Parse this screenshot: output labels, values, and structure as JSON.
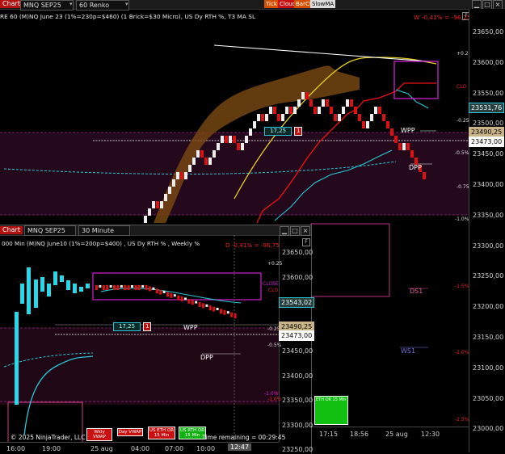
{
  "top": {
    "title_tab": "Chart",
    "instrument": "MNQ SEP25",
    "bar_type": "60 Renko",
    "header_text": "RE 60 (M)NQ June 23 (1%=230p=$460) (1 Brick=$30 Micro), US Dy RTH %, T3 MA SL",
    "pct_readout": "W -0,41% = -96,25",
    "toolbar_buttons": [
      "Tick",
      "Cloud",
      "BarCt",
      "SlowMA"
    ],
    "price_ticks": [
      "23650,00",
      "23600,00",
      "23550,00",
      "23500,00",
      "23450,00",
      "23400,00",
      "23350,00",
      "23300,00",
      "23250,00",
      "23200,00",
      "23150,00",
      "23100,00",
      "23050,00",
      "23000,00"
    ],
    "price_boxes": [
      "23531,76",
      "23490,25",
      "23473,00"
    ],
    "pct_labels": [
      "+0.25",
      "-0.25",
      "-0.5%",
      "-0.75",
      "-1.0%",
      "-1.5%",
      "-2.0%",
      "-2.5%"
    ],
    "level_labels": {
      "clos": "CLO",
      "wpp": "WPP",
      "dpp": "DPP",
      "ds1": "DS1",
      "ws1": "WS1"
    },
    "position": {
      "qty": "17,25",
      "count": "1"
    },
    "time_ticks": [
      "17:15",
      "18:56",
      "25 aug",
      "12:30"
    ],
    "green_panel_label": "ETH OR 15 Min",
    "brick_dir": [
      1,
      1,
      1,
      0,
      1,
      1,
      1,
      1,
      1,
      0,
      1,
      1,
      1,
      1,
      0,
      0,
      1,
      1,
      1,
      1,
      0,
      1,
      0,
      0,
      1,
      1,
      1,
      1,
      1,
      0,
      1,
      1,
      0,
      0,
      1,
      1,
      0,
      1,
      1,
      1,
      0,
      0,
      0,
      1,
      1,
      0,
      0,
      0,
      1,
      1,
      1,
      0,
      0,
      0,
      0,
      1,
      1,
      1,
      0,
      0,
      0,
      0,
      0,
      0,
      1,
      0,
      0,
      0,
      0,
      0
    ]
  },
  "bottom": {
    "title_tab": "Chart",
    "instrument": "MNQ SEP25",
    "bar_type": "30 Minute",
    "header_text": "000 Min (M)NQ June10 (1%=200p=$400) , US Dy RTH % , Weekly %",
    "pct_readout": "D -0,41% = -96,75",
    "price_ticks": [
      "23650,00",
      "23600,00",
      "23550,00",
      "23500,00",
      "23450,00",
      "23400,00",
      "23350,00",
      "23300,00",
      "23250,00"
    ],
    "price_boxes": [
      "23543,02",
      "23490,25",
      "23473,00"
    ],
    "pct_labels": [
      "+0.25",
      "CLOSE",
      "CLO",
      "-0.25",
      "-0.5%",
      "-1.0%"
    ],
    "level_labels": {
      "wpp": "WPP",
      "dpp": "DPP"
    },
    "position": {
      "qty": "17,25",
      "count": "1"
    },
    "time_ticks": [
      "16:00",
      "19:00",
      "25 aug",
      "04:00",
      "07:00",
      "10:00",
      "12:47"
    ],
    "copyright": "© 2025 NinjaTrader, LLC",
    "vwap_buttons": [
      "Wkly VWAP",
      "Day VWAP",
      "US ETH OR 15 Min",
      "US RTH OR 15 Min"
    ],
    "time_remaining": "Time remaining = 00:29:45"
  },
  "colors": {
    "bull": "#eeeeee",
    "bear": "#dd1111",
    "cyan": "#28c8d8",
    "magenta": "#d020d0",
    "yellow": "#e8d020",
    "orange_cloud": "#8a5a1a",
    "red_line": "#ee1111"
  }
}
